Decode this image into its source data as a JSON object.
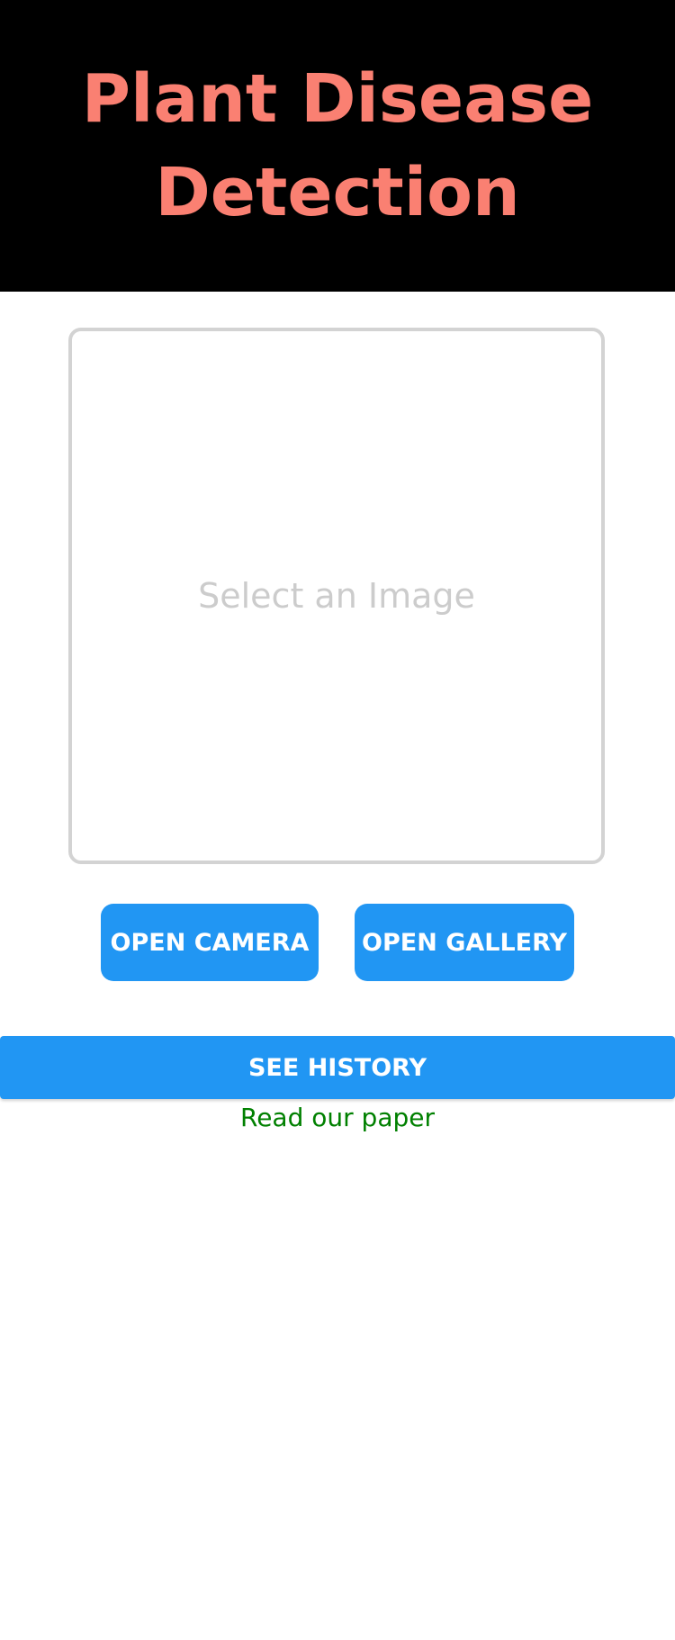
{
  "header": {
    "title": "Plant Disease Detection",
    "background_color": "#000000",
    "title_color": "#fa8072"
  },
  "image_picker": {
    "placeholder": "Select an Image",
    "border_color": "#d3d3d3",
    "placeholder_color": "#cccccc"
  },
  "actions": {
    "open_camera_label": "OPEN CAMERA",
    "open_gallery_label": "OPEN GALLERY",
    "see_history_label": "SEE HISTORY",
    "button_color": "#2196f3"
  },
  "footer": {
    "paper_link_label": "Read our paper",
    "link_color": "#008000"
  }
}
